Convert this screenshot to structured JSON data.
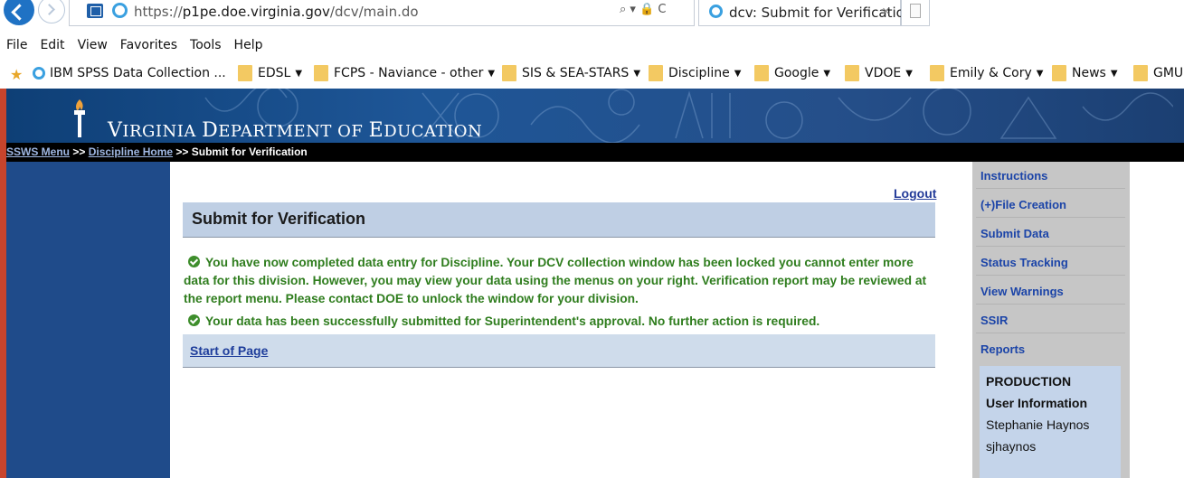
{
  "browser": {
    "url_prefix": "https://",
    "url_host": "p1pe.doe.virginia.gov",
    "url_path": "/dcv/main.do",
    "address_tools": "⌕ ▾ 🔒 C",
    "tab_title": "dcv: Submit for Verification",
    "tab_close": "×",
    "menu": [
      "File",
      "Edit",
      "View",
      "Favorites",
      "Tools",
      "Help"
    ],
    "favorites": [
      {
        "label": "IBM SPSS Data Collection ...",
        "icon": "ie-page-icon",
        "caret": ""
      },
      {
        "label": "EDSL",
        "icon": "folder-icon",
        "caret": "▼"
      },
      {
        "label": "FCPS - Naviance - other",
        "icon": "folder-icon",
        "caret": "▼"
      },
      {
        "label": "SIS & SEA-STARS",
        "icon": "folder-icon",
        "caret": "▼"
      },
      {
        "label": "Discipline",
        "icon": "folder-icon",
        "caret": "▼"
      },
      {
        "label": "Google",
        "icon": "folder-icon",
        "caret": "▼"
      },
      {
        "label": "VDOE",
        "icon": "folder-icon",
        "caret": "▼"
      },
      {
        "label": "Emily & Cory",
        "icon": "folder-icon",
        "caret": "▼"
      },
      {
        "label": "News",
        "icon": "folder-icon",
        "caret": "▼"
      },
      {
        "label": "GMU",
        "icon": "folder-icon",
        "caret": ""
      }
    ]
  },
  "header": {
    "agency_v": "V",
    "agency_irginia": "IRGINIA ",
    "agency_d": "D",
    "agency_epartment": "EPARTMENT OF ",
    "agency_e": "E",
    "agency_ducation": "DUCATION"
  },
  "breadcrumb": {
    "sws_menu": "SSWS Menu",
    "sep1": " >> ",
    "discipline_home": "Discipline Home",
    "sep2": " >> ",
    "current": "Submit for Verification"
  },
  "main": {
    "logout": "Logout",
    "title": "Submit for Verification",
    "message_locked": "You have now completed data entry for Discipline. Your DCV collection window has been locked you cannot enter more data for this division. However, you may view your data using the menus on your right. Verification report may be reviewed at the report menu. Please contact DOE to unlock the window for your division.",
    "message_submitted": "Your data has been successfully submitted for Superintendent's approval. No further action is required.",
    "start_of_page": "Start of Page"
  },
  "right_menu": {
    "items": [
      "Instructions",
      "(+)File Creation",
      "Submit Data",
      "Status Tracking",
      "View Warnings",
      "SSIR",
      "Reports"
    ]
  },
  "user_info": {
    "environment": "PRODUCTION",
    "heading": "User Information",
    "name": "Stephanie Haynos",
    "username": "sjhaynos"
  },
  "colors": {
    "banner": "#1e5697",
    "left_panel": "#1f4b8a",
    "title_box": "#bfcfe4",
    "success_text": "#2f7d1e",
    "right_menu": "#c6c6c6",
    "link": "#1b44a8"
  }
}
